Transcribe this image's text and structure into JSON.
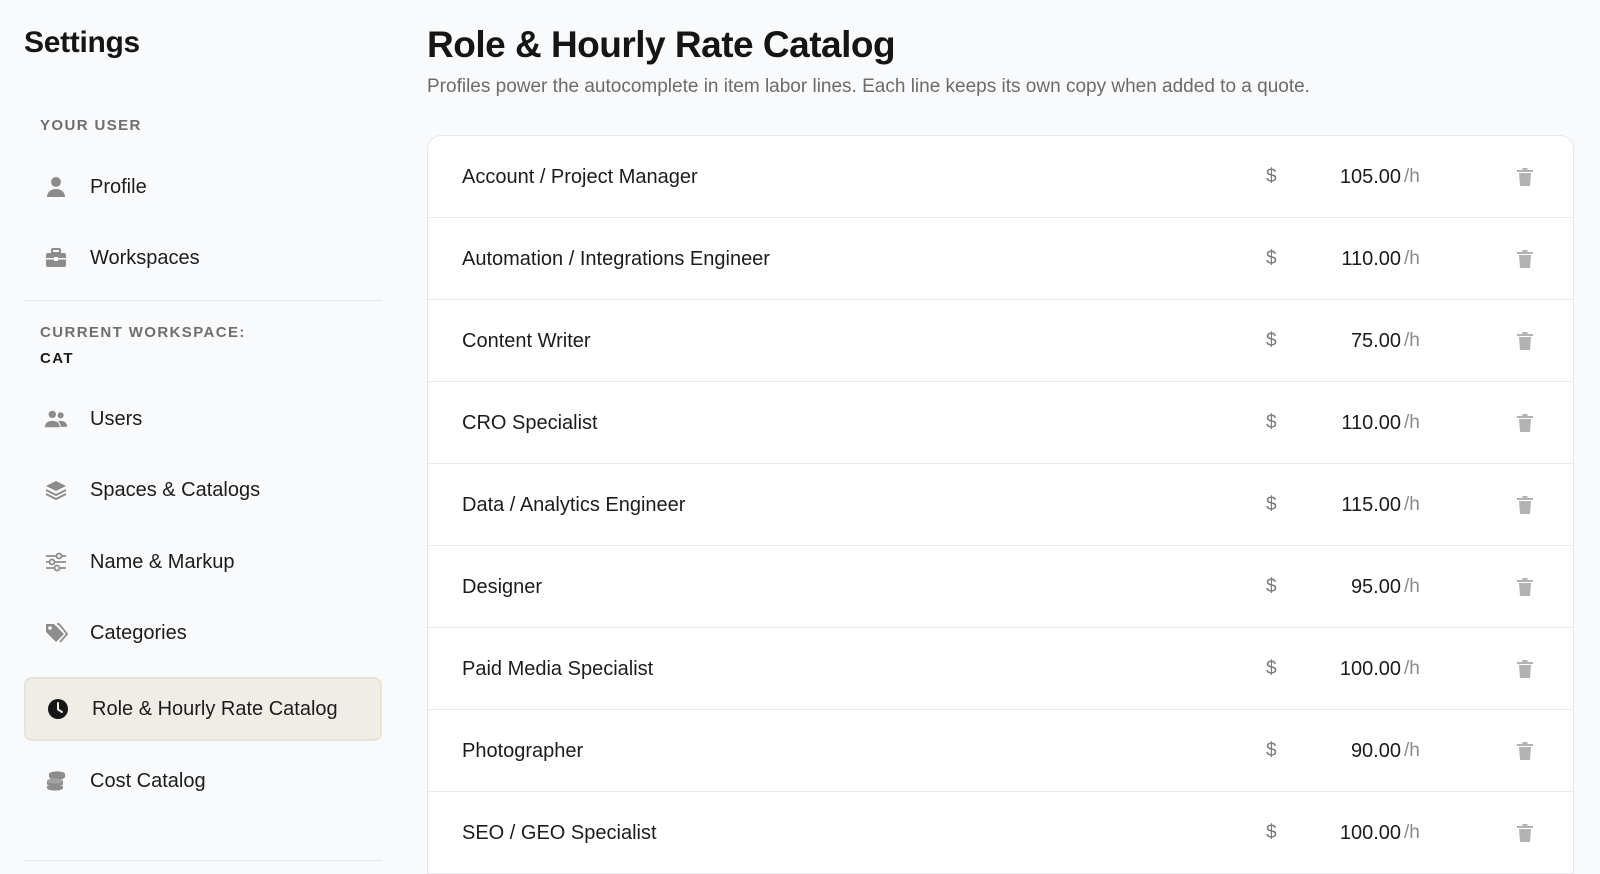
{
  "sidebar": {
    "title": "Settings",
    "user_section_label": "YOUR USER",
    "user_items": [
      {
        "label": "Profile",
        "icon": "person-icon"
      },
      {
        "label": "Workspaces",
        "icon": "briefcase-icon"
      }
    ],
    "workspace_section_label": "CURRENT WORKSPACE:",
    "workspace_name": "CAT",
    "workspace_items": [
      {
        "label": "Users",
        "icon": "users-icon"
      },
      {
        "label": "Spaces & Catalogs",
        "icon": "layers-icon"
      },
      {
        "label": "Name & Markup",
        "icon": "sliders-icon"
      },
      {
        "label": "Categories",
        "icon": "tags-icon"
      },
      {
        "label": "Role & Hourly Rate Catalog",
        "icon": "clock-icon",
        "active": true
      },
      {
        "label": "Cost Catalog",
        "icon": "coins-icon"
      }
    ]
  },
  "main": {
    "title": "Role & Hourly Rate Catalog",
    "description": "Profiles power the autocomplete in item labor lines. Each line keeps its own copy when added to a quote.",
    "currency_symbol": "$",
    "unit": "/h",
    "roles": [
      {
        "name": "Account / Project Manager",
        "rate": "105.00"
      },
      {
        "name": "Automation / Integrations Engineer",
        "rate": "110.00"
      },
      {
        "name": "Content Writer",
        "rate": "75.00"
      },
      {
        "name": "CRO Specialist",
        "rate": "110.00"
      },
      {
        "name": "Data / Analytics Engineer",
        "rate": "115.00"
      },
      {
        "name": "Designer",
        "rate": "95.00"
      },
      {
        "name": "Paid Media Specialist",
        "rate": "100.00"
      },
      {
        "name": "Photographer",
        "rate": "90.00"
      },
      {
        "name": "SEO / GEO Specialist",
        "rate": "100.00"
      }
    ]
  },
  "colors": {
    "background": "#f9fafc",
    "active_nav_bg": "#efede5",
    "icon_gray": "#8c8c8c",
    "trash_gray": "#b3b3b3"
  }
}
